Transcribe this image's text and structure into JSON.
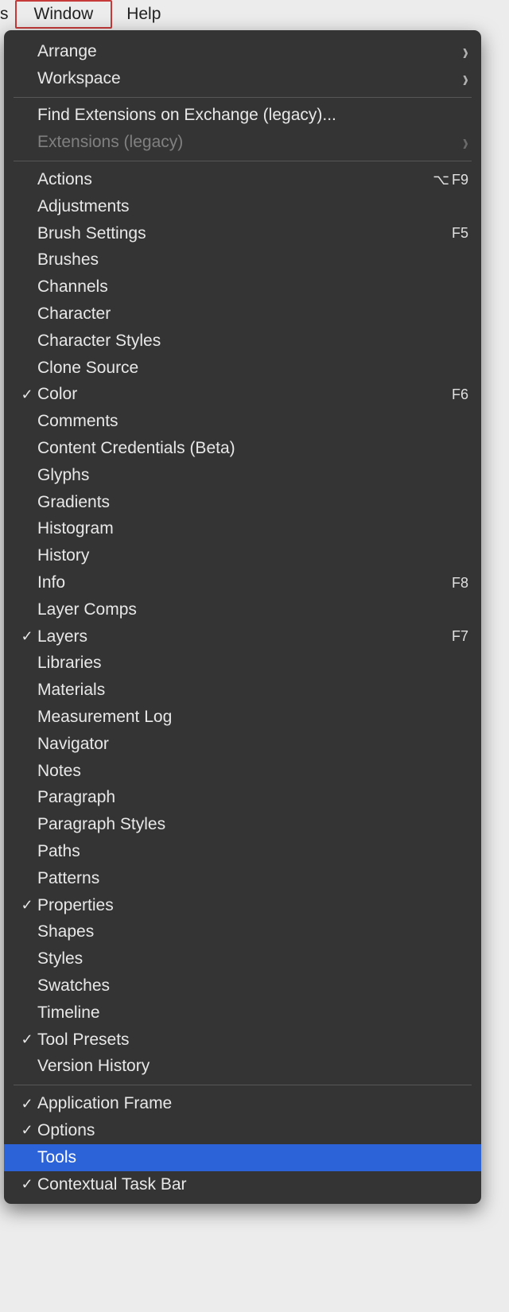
{
  "menubar": {
    "partial": "s",
    "window": "Window",
    "help": "Help"
  },
  "menu": {
    "groups": [
      [
        {
          "label": "Arrange",
          "submenu": true
        },
        {
          "label": "Workspace",
          "submenu": true
        }
      ],
      [
        {
          "label": "Find Extensions on Exchange (legacy)..."
        },
        {
          "label": "Extensions (legacy)",
          "submenu": true,
          "disabled": true
        }
      ],
      [
        {
          "label": "Actions",
          "shortcut_opt": "⌥",
          "shortcut_key": "F9"
        },
        {
          "label": "Adjustments"
        },
        {
          "label": "Brush Settings",
          "shortcut_key": "F5"
        },
        {
          "label": "Brushes"
        },
        {
          "label": "Channels"
        },
        {
          "label": "Character"
        },
        {
          "label": "Character Styles"
        },
        {
          "label": "Clone Source"
        },
        {
          "label": "Color",
          "checked": true,
          "shortcut_key": "F6"
        },
        {
          "label": "Comments"
        },
        {
          "label": "Content Credentials (Beta)"
        },
        {
          "label": "Glyphs"
        },
        {
          "label": "Gradients"
        },
        {
          "label": "Histogram"
        },
        {
          "label": "History"
        },
        {
          "label": "Info",
          "shortcut_key": "F8"
        },
        {
          "label": "Layer Comps"
        },
        {
          "label": "Layers",
          "checked": true,
          "shortcut_key": "F7"
        },
        {
          "label": "Libraries"
        },
        {
          "label": "Materials"
        },
        {
          "label": "Measurement Log"
        },
        {
          "label": "Navigator"
        },
        {
          "label": "Notes"
        },
        {
          "label": "Paragraph"
        },
        {
          "label": "Paragraph Styles"
        },
        {
          "label": "Paths"
        },
        {
          "label": "Patterns"
        },
        {
          "label": "Properties",
          "checked": true
        },
        {
          "label": "Shapes"
        },
        {
          "label": "Styles"
        },
        {
          "label": "Swatches"
        },
        {
          "label": "Timeline"
        },
        {
          "label": "Tool Presets",
          "checked": true
        },
        {
          "label": "Version History"
        }
      ],
      [
        {
          "label": "Application Frame",
          "checked": true
        },
        {
          "label": "Options",
          "checked": true
        },
        {
          "label": "Tools",
          "selected": true
        },
        {
          "label": "Contextual Task Bar",
          "checked": true
        }
      ]
    ]
  }
}
